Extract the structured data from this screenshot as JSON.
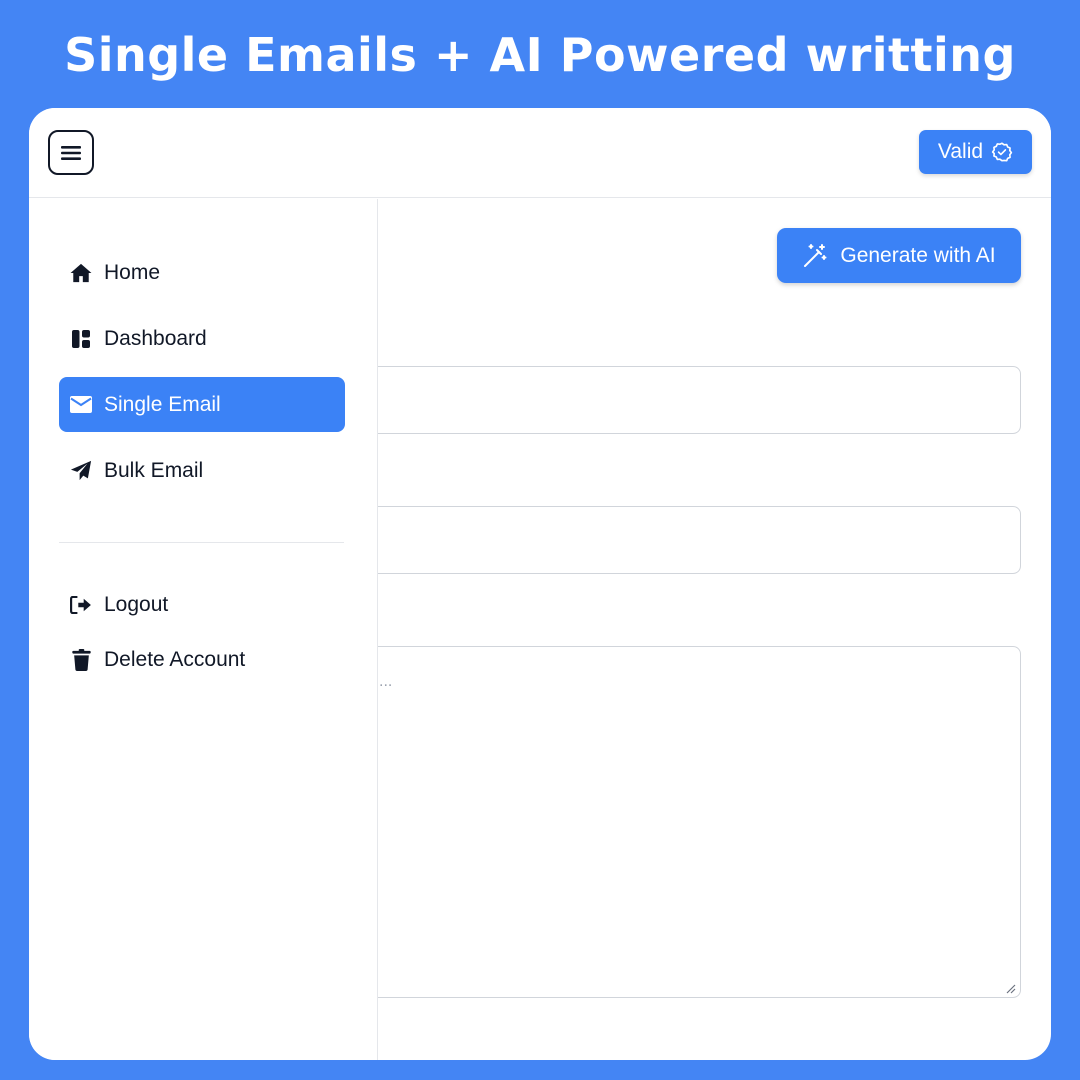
{
  "promo": {
    "title": "Single Emails + AI Powered writting"
  },
  "header": {
    "menu_icon": "hamburger-icon",
    "badge_label": "Valid",
    "badge_icon": "verified-badge-icon"
  },
  "sidebar": {
    "items": [
      {
        "label": "Home",
        "icon": "home-icon",
        "active": false
      },
      {
        "label": "Dashboard",
        "icon": "dashboard-icon",
        "active": false
      },
      {
        "label": "Single Email",
        "icon": "envelope-icon",
        "active": true
      },
      {
        "label": "Bulk Email",
        "icon": "paper-plane-icon",
        "active": false
      }
    ],
    "secondary_items": [
      {
        "label": "Logout",
        "icon": "logout-icon"
      },
      {
        "label": "Delete Account",
        "icon": "trash-icon"
      }
    ]
  },
  "main": {
    "generate_label": "Generate with AI",
    "generate_icon": "magic-wand-icon",
    "message_placeholder_visible": "..."
  },
  "colors": {
    "background": "#4485F4",
    "accent": "#3B82F6",
    "text": "#111827"
  }
}
